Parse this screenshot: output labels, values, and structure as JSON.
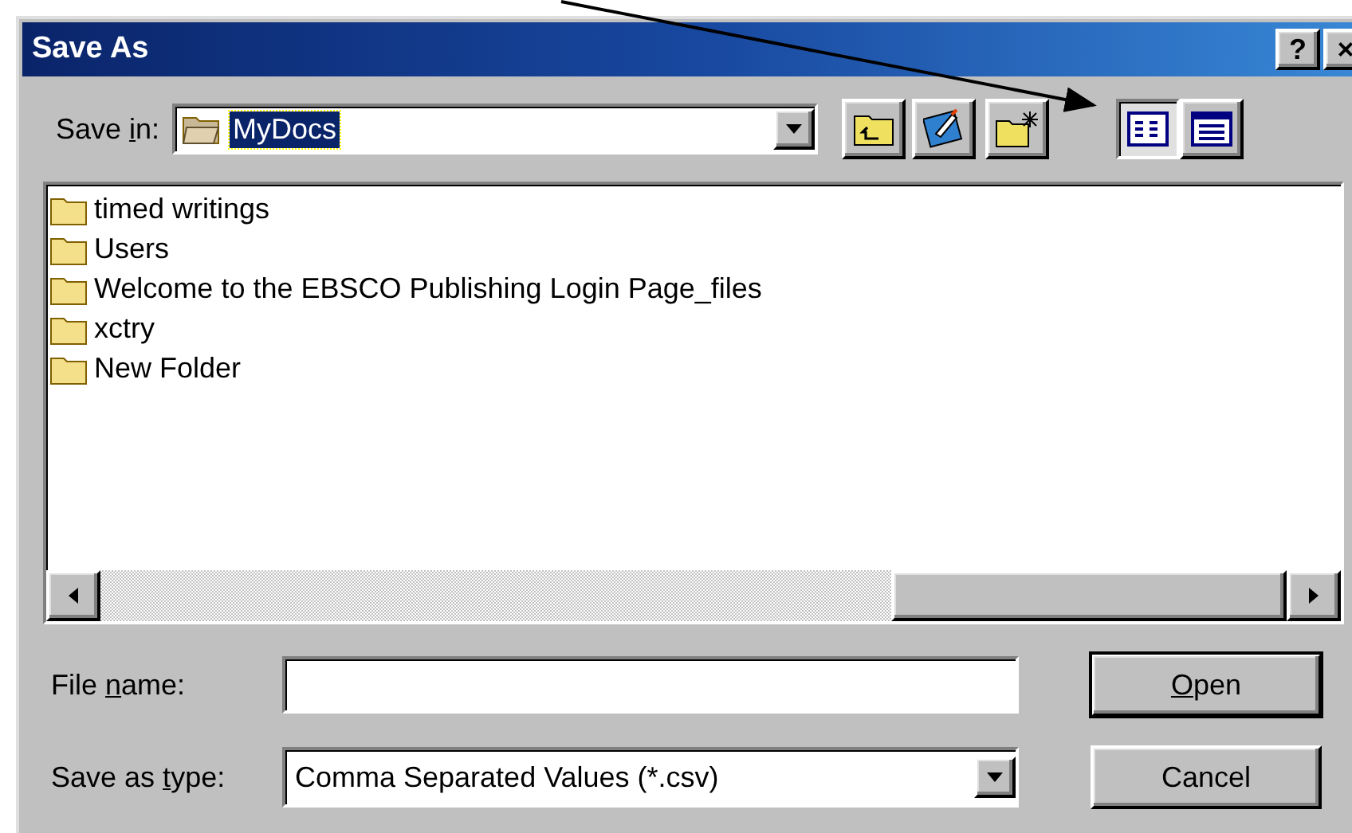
{
  "window": {
    "title": "Save As",
    "title_buttons": [
      "?",
      "×"
    ]
  },
  "save_in": {
    "label_parts": {
      "before": "Save ",
      "key": "i",
      "after": "n:"
    },
    "value": "MyDocs",
    "highlighted": true
  },
  "toolbar": [
    {
      "kind": "up",
      "selected": false
    },
    {
      "kind": "desktop",
      "selected": false
    },
    {
      "kind": "new-folder",
      "selected": false
    },
    {
      "kind": "list",
      "selected": true
    },
    {
      "kind": "details",
      "selected": false
    }
  ],
  "files": [
    {
      "name": "timed writings"
    },
    {
      "name": "Users"
    },
    {
      "name": "Welcome to the EBSCO Publishing Login Page_files"
    },
    {
      "name": "xctry"
    },
    {
      "name": "New Folder"
    }
  ],
  "file_name": {
    "label_parts": {
      "before": "File ",
      "key": "n",
      "after": "ame:"
    }
  },
  "save_as_type": {
    "label_parts": {
      "before": "Save as ",
      "key": "t",
      "after": "ype:"
    },
    "value": "Comma Separated Values (*.csv)"
  },
  "buttons": [
    {
      "label_parts": {
        "key": "O",
        "after": "pen"
      },
      "default": true
    },
    {
      "label_parts": {
        "before": "Cancel"
      },
      "default": false
    }
  ],
  "annotation": {
    "kind": "arrow"
  }
}
